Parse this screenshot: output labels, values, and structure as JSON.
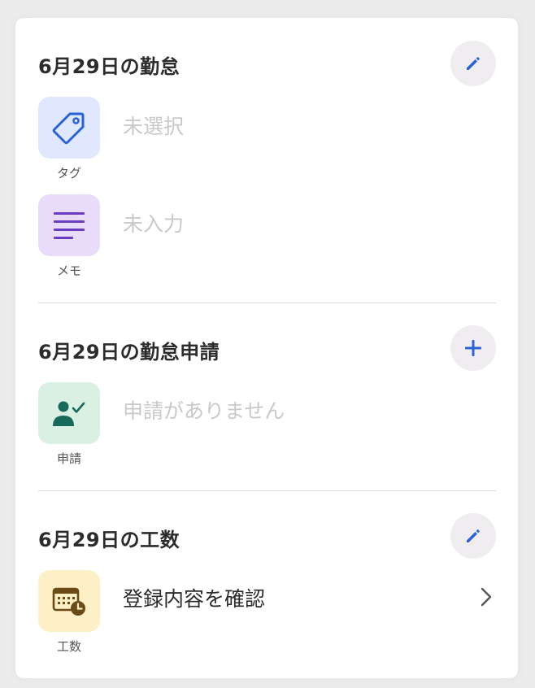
{
  "attendance": {
    "title": "6月29日の勤怠",
    "tag": {
      "label": "タグ",
      "value": "未選択"
    },
    "memo": {
      "label": "メモ",
      "value": "未入力"
    }
  },
  "request": {
    "title": "6月29日の勤怠申請",
    "item": {
      "label": "申請",
      "value": "申請がありません"
    }
  },
  "workhours": {
    "title": "6月29日の工数",
    "item": {
      "label": "工数",
      "value": "登録内容を確認"
    }
  },
  "icons": {
    "edit": "pencil-icon",
    "add": "plus-icon",
    "tag": "tag-icon",
    "memo": "lines-icon",
    "request": "person-check-icon",
    "workhours": "calendar-clock-icon",
    "chevron": "chevron-right-icon"
  },
  "colors": {
    "accent": "#2a63d6",
    "tag_bg": "#dfe8fc",
    "memo_bg": "#e9dcfb",
    "memo_fg": "#6a3cc2",
    "request_bg": "#d9f0e3",
    "request_fg": "#176b5a",
    "workhours_bg": "#fdf0c6",
    "workhours_fg": "#6b4a16"
  }
}
